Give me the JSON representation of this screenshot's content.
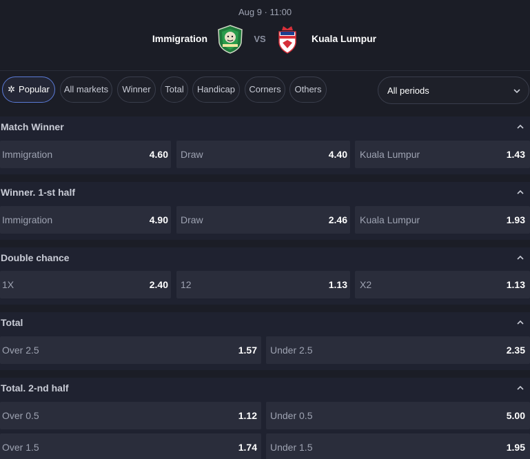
{
  "match": {
    "time": "Aug 9 · 11:00",
    "home": "Immigration",
    "away": "Kuala Lumpur",
    "vs": "VS"
  },
  "filters": {
    "chips": [
      "Popular",
      "All markets",
      "Winner",
      "Total",
      "Handicap",
      "Corners",
      "Others"
    ],
    "active": "Popular",
    "period": "All periods"
  },
  "markets": [
    {
      "title": "Match Winner",
      "outcomes": [
        {
          "label": "Immigration",
          "odds": "4.60"
        },
        {
          "label": "Draw",
          "odds": "4.40"
        },
        {
          "label": "Kuala Lumpur",
          "odds": "1.43"
        }
      ]
    },
    {
      "title": "Winner. 1-st half",
      "outcomes": [
        {
          "label": "Immigration",
          "odds": "4.90"
        },
        {
          "label": "Draw",
          "odds": "2.46"
        },
        {
          "label": "Kuala Lumpur",
          "odds": "1.93"
        }
      ]
    },
    {
      "title": "Double chance",
      "outcomes": [
        {
          "label": "1X",
          "odds": "2.40"
        },
        {
          "label": "12",
          "odds": "1.13"
        },
        {
          "label": "X2",
          "odds": "1.13"
        }
      ]
    },
    {
      "title": "Total",
      "outcomes": [
        {
          "label": "Over 2.5",
          "odds": "1.57"
        },
        {
          "label": "Under 2.5",
          "odds": "2.35"
        }
      ]
    },
    {
      "title": "Total. 2-nd half",
      "outcomes": [
        {
          "label": "Over 0.5",
          "odds": "1.12"
        },
        {
          "label": "Under 0.5",
          "odds": "5.00"
        },
        {
          "label": "Over 1.5",
          "odds": "1.74"
        },
        {
          "label": "Under 1.5",
          "odds": "1.95"
        }
      ]
    }
  ],
  "colors": {
    "background": "#1b1d26",
    "cell": "#2a2d3b",
    "active_border": "#5b7bd8"
  },
  "icons": {
    "popular": "sparkle-icon",
    "home_logo": "lion-crest-icon",
    "away_logo": "kl-crest-icon",
    "collapse": "chevron-up-icon",
    "period": "chevron-down-icon"
  }
}
